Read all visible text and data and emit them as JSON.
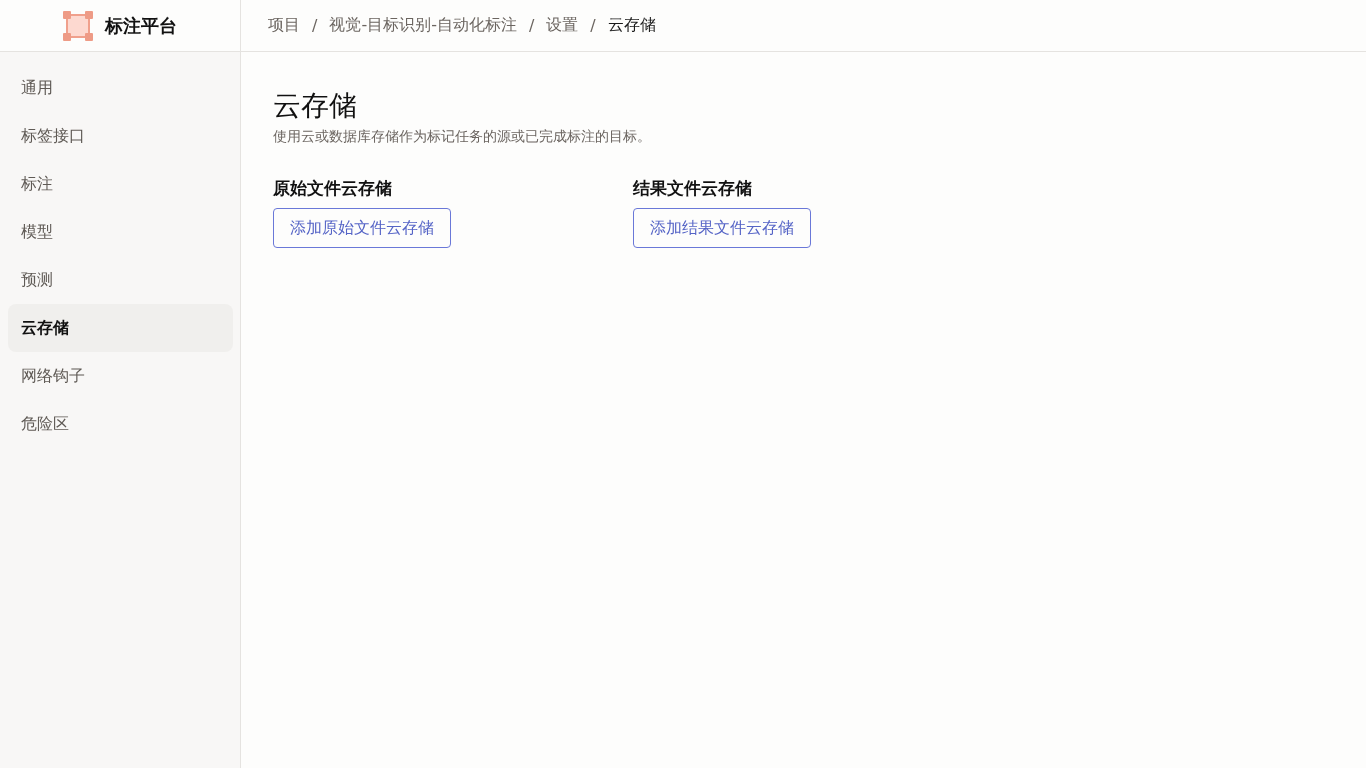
{
  "logo": {
    "text": "标注平台"
  },
  "breadcrumb": {
    "items": [
      {
        "label": "项目",
        "current": false
      },
      {
        "label": "视觉-目标识别-自动化标注",
        "current": false
      },
      {
        "label": "设置",
        "current": false
      },
      {
        "label": "云存储",
        "current": true
      }
    ],
    "separators": [
      "/",
      "/",
      "/"
    ]
  },
  "sidebar": {
    "items": [
      {
        "label": "通用",
        "selected": false
      },
      {
        "label": "标签接口",
        "selected": false
      },
      {
        "label": "标注",
        "selected": false
      },
      {
        "label": "模型",
        "selected": false
      },
      {
        "label": "预测",
        "selected": false
      },
      {
        "label": "云存储",
        "selected": true
      },
      {
        "label": "网络钩子",
        "selected": false
      },
      {
        "label": "危险区",
        "selected": false
      }
    ]
  },
  "page": {
    "title": "云存储",
    "description": "使用云或数据库存储作为标记任务的源或已完成标注的目标。",
    "sections": [
      {
        "heading": "原始文件云存储",
        "button": "添加原始文件云存储"
      },
      {
        "heading": "结果文件云存储",
        "button": "添加结果文件云存储"
      }
    ]
  }
}
